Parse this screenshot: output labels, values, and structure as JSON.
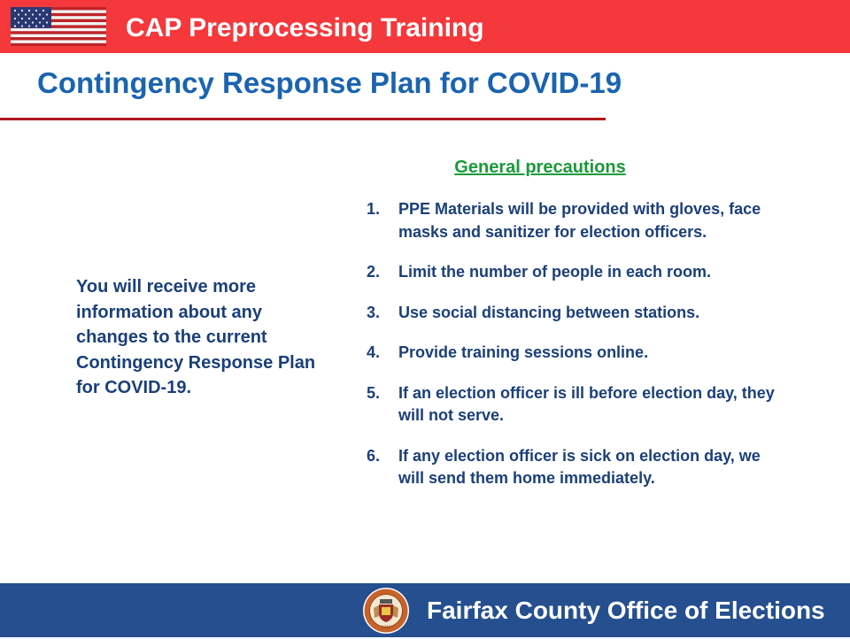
{
  "header": {
    "title": "CAP Preprocessing Training",
    "flag_icon": "us-flag-icon",
    "bar_color": "#f4383c"
  },
  "slide": {
    "title": "Contingency Response Plan for COVID-19",
    "title_color": "#1a64b0",
    "rule_color": "#b0171c"
  },
  "left_note": {
    "text": "You will receive more information about any changes to the current Contingency Response Plan for COVID-19."
  },
  "precautions": {
    "heading": "General precautions",
    "heading_color": "#1a9a3a",
    "items": [
      {
        "number": "1.",
        "text": "PPE Materials will be provided with gloves, face masks and sanitizer for election officers."
      },
      {
        "number": "2.",
        "text": "Limit the number of people in each room."
      },
      {
        "number": "3.",
        "text": "Use social distancing between stations."
      },
      {
        "number": "4.",
        "text": "Provide training sessions online."
      },
      {
        "number": "5.",
        "text": "If an election officer is ill before election day, they will not serve."
      },
      {
        "number": "6.",
        "text": "If any election officer is sick on election day, we will send them home immediately."
      }
    ]
  },
  "footer": {
    "text": "Fairfax County Office of Elections",
    "seal_icon": "fairfax-county-seal-icon",
    "seal_year": "1742",
    "bar_color": "#254f8f"
  }
}
